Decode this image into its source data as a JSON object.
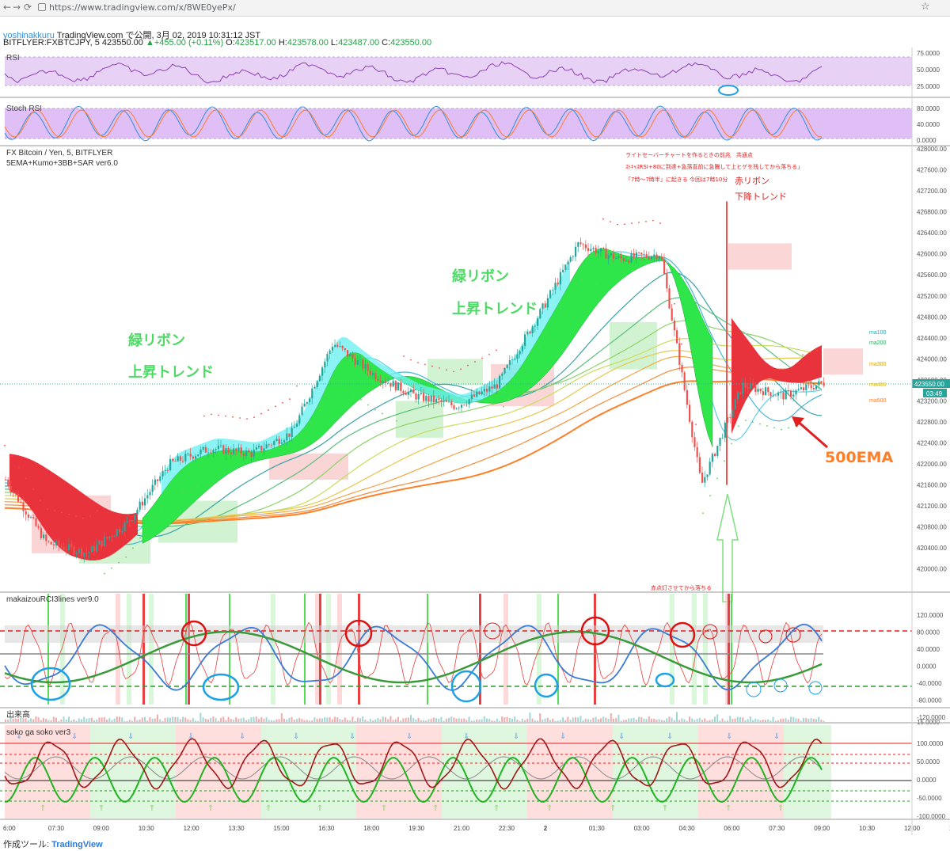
{
  "browser": {
    "back": "←",
    "forward": "→",
    "reload": "⟳",
    "url": "https://www.tradingview.com/x/8WE0yePx/",
    "star": "☆"
  },
  "header": {
    "user": "yoshinakkuru",
    "published": "TradingView.com で公開, 3月 02, 2019 10:31:12 JST",
    "symbol": "BITFLYER:FXBTCJPY, 5 423550.00",
    "change": "▲+455.00 (+0.11%)",
    "o_label": "O:",
    "o_val": "423517.00",
    "h_label": "H:",
    "h_val": "423578.00",
    "l_label": "L:",
    "l_val": "423487.00",
    "c_label": "C:",
    "c_val": "423550.00"
  },
  "panes": {
    "rsi": {
      "title": "RSI",
      "ticks": [
        "75.0000",
        "50.0000",
        "25.0000"
      ]
    },
    "stoch": {
      "title": "Stoch RSI",
      "ticks": [
        "80.0000",
        "40.0000",
        "0.0000"
      ]
    },
    "main": {
      "title1": "FX Bitcoin / Yen, 5, BITFLYER",
      "title2": "5EMA+Kumo+3BB+SAR ver6.0",
      "ticks": [
        "428000.00",
        "427600.00",
        "427200.00",
        "426800.00",
        "426400.00",
        "426000.00",
        "425600.00",
        "425200.00",
        "424800.00",
        "424400.00",
        "424000.00",
        "423600.00",
        "423200.00",
        "422800.00",
        "422400.00",
        "422000.00",
        "421600.00",
        "421200.00",
        "420800.00",
        "420400.00",
        "420000.00"
      ],
      "ma_labels": [
        "ma100",
        "ma200",
        "ma300",
        "ma400",
        "ma500"
      ],
      "price_label": "423550.00",
      "countdown": "03:49"
    },
    "rci": {
      "title": "makaizouRCI3lines ver9.0",
      "ticks": [
        "120.0000",
        "80.0000",
        "40.0000",
        "0.0000",
        "-40.0000",
        "-80.0000",
        "-120.0000"
      ]
    },
    "volume": {
      "title": "出来高",
      "ticks": [
        "15.0000"
      ]
    },
    "soko": {
      "title": "soko ga soko ver3",
      "ticks": [
        "100.0000",
        "50.0000",
        "0.0000",
        "-50.0000",
        "-100.0000"
      ]
    }
  },
  "annotations": {
    "green_ribbon": "緑リボン",
    "uptrend": "上昇トレンド",
    "red_ribbon": "赤リボン",
    "downtrend": "下降トレンド",
    "note_lines": [
      "ライトセーバーチャートを作るときの前兆　共通点",
      "ｽﾄｷｬｽRSI+80に到達+急落直前に急騰して上ヒゲを残してから落ちる」",
      "「7時～7時半」に起きる 今回は7時10分"
    ],
    "note_bottom": "赤点灯させてから落ちる",
    "ema500": "500EMA"
  },
  "time_axis": [
    "6:00",
    "07:30",
    "09:00",
    "10:30",
    "12:00",
    "13:30",
    "15:00",
    "16:30",
    "18:00",
    "19:30",
    "21:00",
    "22:30",
    "2",
    "01:30",
    "03:00",
    "04:30",
    "06:00",
    "07:30",
    "09:00",
    "10:30",
    "12:00",
    "13:"
  ],
  "footer": {
    "label": "作成ツール:",
    "brand": "TradingView"
  },
  "colors": {
    "up": "#26a69a",
    "down": "#ef5350",
    "ribbon_green": "#2ee64a",
    "ribbon_red": "#e8323c",
    "rsi_bg": "#e7d2f5",
    "stoch_bg": "#dfbff5",
    "annotation_green": "#4cd964",
    "annotation_red": "#e02020",
    "ema500": "#ff7f27",
    "circle_blue": "#1da1e6",
    "circle_red": "#dd1111"
  },
  "chart_data": {
    "type": "line",
    "title": "FX Bitcoin / Yen, 5, BITFLYER",
    "x": [
      "06:00",
      "07:30",
      "09:00",
      "10:30",
      "12:00",
      "13:30",
      "15:00",
      "16:30",
      "18:00",
      "19:30",
      "21:00",
      "22:30",
      "00:00",
      "01:30",
      "03:00",
      "04:30",
      "06:00",
      "07:10",
      "07:30",
      "09:00",
      "10:30"
    ],
    "series": [
      {
        "name": "FXBTCJPY",
        "values": [
          421700,
          420500,
          420300,
          420900,
          422000,
          422300,
          422200,
          422600,
          424300,
          423700,
          423300,
          423100,
          423500,
          424800,
          426200,
          425900,
          426000,
          421600,
          423500,
          423300,
          423550
        ]
      }
    ],
    "ylim": [
      419800,
      428000
    ],
    "last_close": 423550
  }
}
